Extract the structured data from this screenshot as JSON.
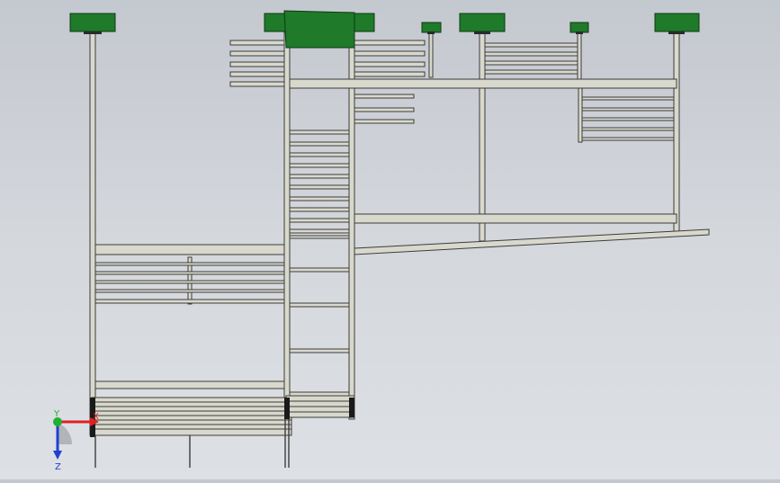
{
  "colors": {
    "background_top": "#c4c8cf",
    "background_bottom": "#dde0e4",
    "frame_fill": "#d8d8cc",
    "frame_stroke": "#3c3c3c",
    "cap_green": "#1f7a2a",
    "axis_x": "#e02020",
    "axis_y": "#20b030",
    "axis_z": "#2040d0"
  },
  "triad": {
    "x_label": "X",
    "y_label": "Y",
    "z_label": "Z"
  }
}
